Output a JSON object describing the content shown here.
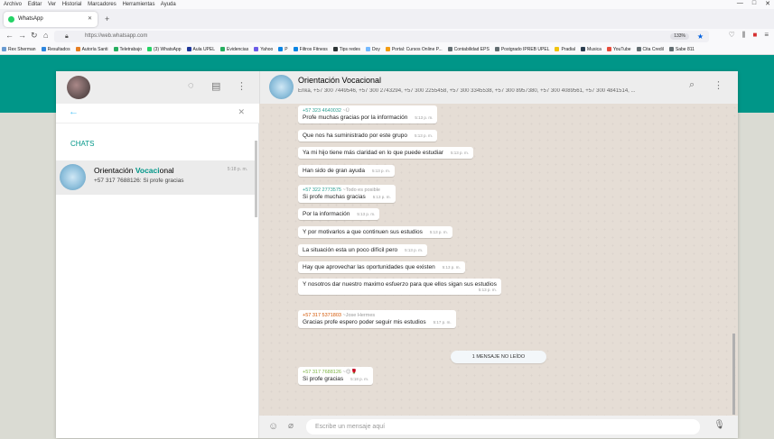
{
  "browser": {
    "menu": [
      "Archivo",
      "Editar",
      "Ver",
      "Historial",
      "Marcadores",
      "Herramientas",
      "Ayuda"
    ],
    "window_controls": [
      "—",
      "□",
      "✕"
    ],
    "tab_title": "WhatsApp",
    "url": "https://web.whatsapp.com",
    "zoom": "133%",
    "bookmarks": [
      {
        "label": "Rex Sherman",
        "color": "#6a9bd1"
      },
      {
        "label": "Resultados",
        "color": "#2e86de"
      },
      {
        "label": "Autoría Santi",
        "color": "#e67e22"
      },
      {
        "label": "Teletrabajo",
        "color": "#27ae60"
      },
      {
        "label": "(3) WhatsApp",
        "color": "#25d366"
      },
      {
        "label": "Aula UPEL",
        "color": "#1e3799"
      },
      {
        "label": "Evidencias",
        "color": "#27ae60"
      },
      {
        "label": "Yahoo",
        "color": "#6c5ce7"
      },
      {
        "label": "P",
        "color": "#0984e3"
      },
      {
        "label": "Filtros Fitness",
        "color": "#0984e3"
      },
      {
        "label": "Tips redes",
        "color": "#2d3436"
      },
      {
        "label": "Doy",
        "color": "#74b9ff"
      },
      {
        "label": "Portal: Cursos Online P...",
        "color": "#f39c12"
      },
      {
        "label": "Contabilidad EPS",
        "color": "#636e72"
      },
      {
        "label": "Postgrado IPREB UPEL",
        "color": "#636e72"
      },
      {
        "label": "Pradial",
        "color": "#f1c40f"
      },
      {
        "label": "Musica",
        "color": "#2c3e50"
      },
      {
        "label": "YouTube",
        "color": "#e74c3c"
      },
      {
        "label": "Cita Credil",
        "color": "#636e72"
      },
      {
        "label": "Sabe 811",
        "color": "#636e72"
      }
    ]
  },
  "whatsapp": {
    "accent_color": "#009688",
    "sidebar": {
      "chats_label": "CHATS",
      "chat": {
        "name_part1": "Orientación ",
        "name_highlight": "Vocaci",
        "name_part2": "onal",
        "time": "5:18 p. m.",
        "preview": "+57 317 7688126: Si profe gracias"
      }
    },
    "conversation": {
      "title": "Orientación Vocacional",
      "members": "Erika, +57 300 7449546, +57 300 2743294, +57 300 2255458, +57 300 3345538, +57 300 8957380, +57 300 4089561, +57 300 4841514, ...",
      "messages": [
        {
          "sender": "+57 323 4640032",
          "nick": "~Ü",
          "text": "Profe muchas gracias por la información",
          "time": "5:13 p. m."
        },
        {
          "text": "Que nos ha suministrado por este grupo",
          "time": "5:13 p. m."
        },
        {
          "text": "Ya mi hijo tiene más claridad en lo que puede estudiar",
          "time": "5:13 p. m."
        },
        {
          "text": "Han sido de gran ayuda",
          "time": "5:13 p. m."
        },
        {
          "sender": "+57 322 2773575",
          "nick": "~Todo es posible",
          "text": "Si profe muchas gracias",
          "time": "5:13 p. m."
        },
        {
          "text": "Por la información",
          "time": "5:13 p. m."
        },
        {
          "text": "Y por motivarlos a que  continuen sus estudios",
          "time": "5:13 p. m."
        },
        {
          "text": "La situación esta un poco difícil pero",
          "time": "5:13 p. m."
        },
        {
          "text": "Hay que aprovechar las oportunidades que existen",
          "time": "5:13 p. m."
        },
        {
          "text": "Y nosotros dar nuestro maximo esfuerzo para que ellos sigan sus estudios",
          "time": "5:13 p. m."
        },
        {
          "sender": "+57 317 5371803",
          "nick": "~Jose Hermes",
          "text": "Gracias profe espero poder seguir mis estudios",
          "time": "5:17 p. m."
        },
        {
          "sender": "+57 317 7688126",
          "nick": "~😊🌹",
          "text": "Si profe gracias",
          "time": "5:18 p. m."
        }
      ],
      "unread_label": "1 MENSAJE NO LEÍDO",
      "composer_placeholder": "Escribe un mensaje aquí"
    }
  }
}
